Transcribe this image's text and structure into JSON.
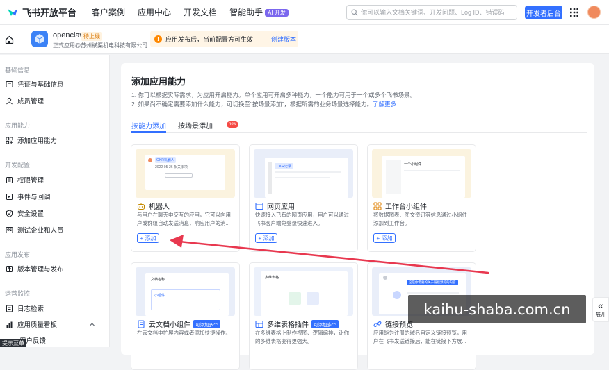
{
  "topnav": {
    "brand": "飞书开放平台",
    "links": [
      "客户案例",
      "应用中心",
      "开发文档",
      "智能助手"
    ],
    "ai_badge": "AI 开发",
    "search_placeholder": "你可以输入文档关键词、开发问题、Log ID、错误码",
    "dev_button": "开发者后台"
  },
  "app": {
    "name": "openclaw",
    "status": "待上线",
    "company": "正式应用@苏州横渠机电科技有限公司",
    "notice": "应用发布后，当前配置方可生效",
    "notice_link": "创建版本"
  },
  "sidebar": {
    "sections": [
      {
        "title": "基础信息",
        "items": [
          "凭证与基础信息",
          "成员管理"
        ]
      },
      {
        "title": "应用能力",
        "items": [
          "添加应用能力"
        ]
      },
      {
        "title": "开发配置",
        "items": [
          "权限管理",
          "事件与回调",
          "安全设置",
          "测试企业和人员"
        ]
      },
      {
        "title": "应用发布",
        "items": [
          "版本管理与发布"
        ]
      },
      {
        "title": "运营监控",
        "items": [
          "日志检索",
          "应用质量看板",
          "用户反馈"
        ]
      }
    ],
    "tooltip": "提示菜单"
  },
  "main": {
    "title": "添加应用能力",
    "desc1": "1. 你可以根据实际需求，为应用开启能力。单个应用可开启多种能力，一个能力可用于一个或多个飞书场景。",
    "desc2": "2. 如果尚不确定需要添加什么能力，可切换至\"按场景添加\"，根据所需的业务场景选择能力。",
    "learn_more": "了解更多",
    "tabs": [
      "按能力添加",
      "按场景添加"
    ],
    "new_badge": "new",
    "cards": [
      {
        "title": "机器人",
        "desc": "与用户在聊天中交互的应用，它可以向用户或群组自动发送消息，响应用户的消...",
        "button": "+ 添加",
        "icon": "robot-icon"
      },
      {
        "title": "网页应用",
        "desc": "快速接入已有的网页应用，用户可以通过飞书客户端免登录快速进入。",
        "button": "+ 添加",
        "icon": "web-icon"
      },
      {
        "title": "工作台小组件",
        "desc": "将数据图表、图文资讯等信息通过小组件添加到工作台。",
        "button": "+ 添加",
        "icon": "widget-icon"
      },
      {
        "title": "云文档小组件",
        "badge": "可添加多个",
        "desc": "在云文档中扩展内容或者添加快捷操作。",
        "icon": "doc-icon"
      },
      {
        "title": "多维表格插件",
        "badge": "可添加多个",
        "desc": "在多维表格上制作视图、逻辑编排，让你的多维表格变得更强大。",
        "icon": "table-icon"
      },
      {
        "title": "链接预览",
        "desc": "应用能为注册的域名自定义链接预览，用户在飞书发送链接后，能在链接下方展...",
        "icon": "link-icon"
      }
    ],
    "mock_texts": {
      "robot_name": "OKR机器人",
      "robot_date": "2022-05-26 相关事项",
      "web_btn": "OKR记录",
      "widget_title": "一个小组件",
      "doc_title": "文档名称",
      "doc_card": "小组件",
      "table_title": "多维表格",
      "link_text": "这是你需要的关于链接预览的内容"
    }
  },
  "overlay": {
    "watermark": "kaihu-shaba.com.cn",
    "expand_label": "展开"
  },
  "colors": {
    "accent": "#3370ff",
    "arrow": "#e8384f",
    "warning": "#ff8800"
  }
}
